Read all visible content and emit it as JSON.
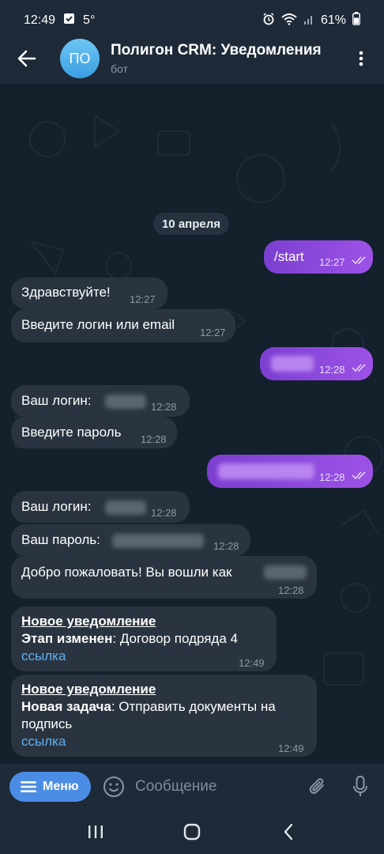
{
  "status_bar": {
    "time": "12:49",
    "temp": "5°",
    "battery": "61%"
  },
  "header": {
    "avatar_initials": "ПО",
    "title": "Полигон CRM: Уведомления",
    "subtitle": "бот"
  },
  "date_chip": "10 апреля",
  "messages": [
    {
      "direction": "out",
      "text": "/start",
      "time": "12:27"
    },
    {
      "direction": "in",
      "text": "Здравствуйте!",
      "time": "12:27"
    },
    {
      "direction": "in",
      "text": "Введите логин или email",
      "time": "12:27"
    },
    {
      "direction": "out",
      "text": "",
      "time": "12:28"
    },
    {
      "direction": "in",
      "text": "Ваш логин:",
      "time": "12:28"
    },
    {
      "direction": "in",
      "text": "Введите пароль",
      "time": "12:28"
    },
    {
      "direction": "out",
      "text": "",
      "time": "12:28"
    },
    {
      "direction": "in",
      "text": "Ваш логин:",
      "time": "12:28"
    },
    {
      "direction": "in",
      "text": "Ваш пароль:",
      "time": "12:28"
    },
    {
      "direction": "in",
      "text": "Добро пожаловать! Вы вошли как",
      "time": "12:28"
    }
  ],
  "notifications": [
    {
      "title": "Новое уведомление",
      "label": "Этап изменен",
      "body": ": Договор подряда 4",
      "body2": "",
      "link": "ссылка",
      "time": "12:49"
    },
    {
      "title": "Новое уведомление",
      "label": "Новая задача",
      "body": ": Отправить документы на",
      "body2": "подпись",
      "link": "ссылка",
      "time": "12:49"
    }
  ],
  "input_bar": {
    "menu_label": "Меню",
    "placeholder": "Сообщение"
  },
  "colors": {
    "outgoing_bubble": "#8e4ade",
    "incoming_bubble": "#2a3440",
    "link": "#5fb1f0",
    "menu_button": "#4b8de4"
  }
}
